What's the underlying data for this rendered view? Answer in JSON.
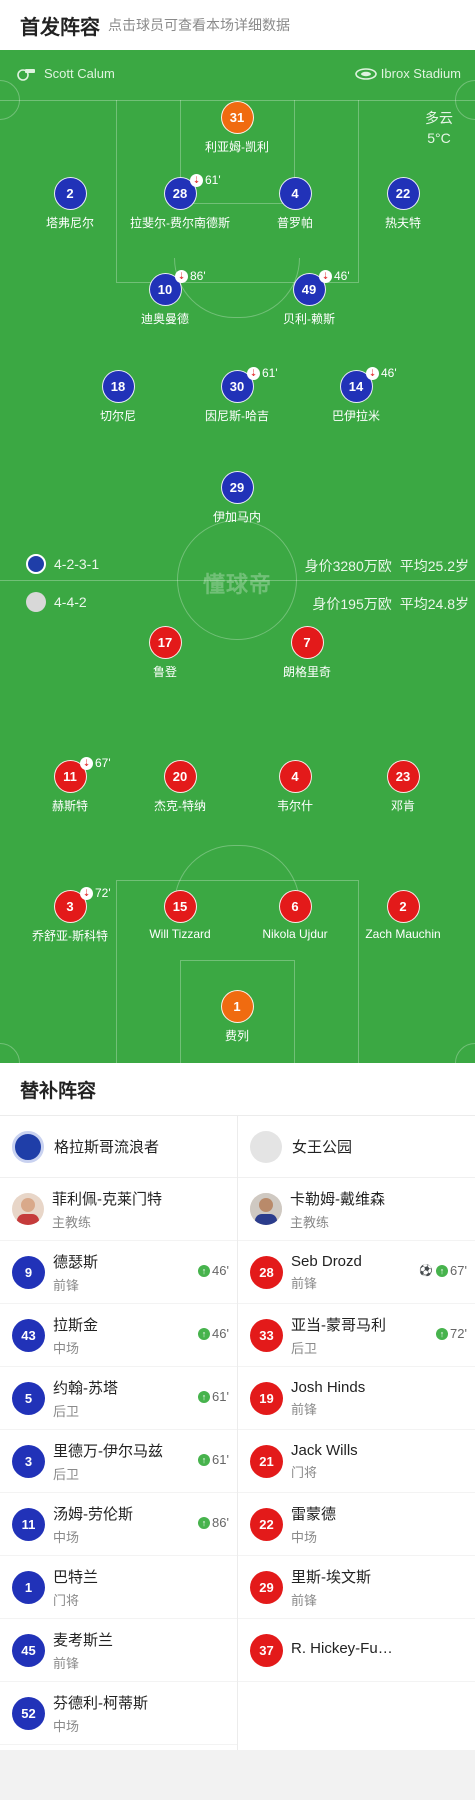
{
  "header": {
    "title": "首发阵容",
    "subtitle": "点击球员可查看本场详细数据"
  },
  "match": {
    "referee": "Scott Calum",
    "stadium": "Ibrox Stadium",
    "weather": "多云",
    "temperature": "5°C",
    "watermark": "懂球帝"
  },
  "home": {
    "formation": "4-2-3-1",
    "value": "身价3280万欧",
    "avg_age": "平均25.2岁"
  },
  "away": {
    "formation": "4-4-2",
    "value": "身价195万欧",
    "avg_age": "平均24.8岁"
  },
  "pitch_players": [
    {
      "num": "31",
      "name": "利亚姆-凯利",
      "color": "orange"
    },
    {
      "num": "2",
      "name": "塔弗尼尔",
      "color": "blue"
    },
    {
      "num": "28",
      "name": "拉斐尔-费尔南德斯",
      "color": "blue",
      "sub": "61'"
    },
    {
      "num": "4",
      "name": "普罗帕",
      "color": "blue"
    },
    {
      "num": "22",
      "name": "热夫特",
      "color": "blue"
    },
    {
      "num": "10",
      "name": "迪奥曼德",
      "color": "blue",
      "sub": "86'"
    },
    {
      "num": "49",
      "name": "贝利-赖斯",
      "color": "blue",
      "sub": "46'"
    },
    {
      "num": "18",
      "name": "切尔尼",
      "color": "blue"
    },
    {
      "num": "30",
      "name": "因尼斯-哈吉",
      "color": "blue",
      "sub": "61'"
    },
    {
      "num": "14",
      "name": "巴伊拉米",
      "color": "blue",
      "sub": "46'"
    },
    {
      "num": "29",
      "name": "伊加马内",
      "color": "blue"
    },
    {
      "num": "17",
      "name": "鲁登",
      "color": "red"
    },
    {
      "num": "7",
      "name": "朗格里奇",
      "color": "red"
    },
    {
      "num": "11",
      "name": "赫斯特",
      "color": "red",
      "sub": "67'"
    },
    {
      "num": "20",
      "name": "杰克-特纳",
      "color": "red"
    },
    {
      "num": "4",
      "name": "韦尔什",
      "color": "red"
    },
    {
      "num": "23",
      "name": "邓肯",
      "color": "red"
    },
    {
      "num": "3",
      "name": "乔舒亚-斯科特",
      "color": "red",
      "sub": "72'"
    },
    {
      "num": "15",
      "name": "Will Tizzard",
      "color": "red"
    },
    {
      "num": "6",
      "name": "Nikola Ujdur",
      "color": "red"
    },
    {
      "num": "2",
      "name": "Zach Mauchin",
      "color": "red"
    },
    {
      "num": "1",
      "name": "费列",
      "color": "orange"
    }
  ],
  "bench": {
    "title": "替补阵容",
    "home_team": "格拉斯哥流浪者",
    "away_team": "女王公园",
    "home_coach": {
      "name": "菲利佩-克莱门特",
      "role": "主教练"
    },
    "away_coach": {
      "name": "卡勒姆-戴维森",
      "role": "主教练"
    },
    "home": [
      {
        "num": "9",
        "name": "德瑟斯",
        "pos": "前锋",
        "sub": "46'"
      },
      {
        "num": "43",
        "name": "拉斯金",
        "pos": "中场",
        "sub": "46'"
      },
      {
        "num": "5",
        "name": "约翰-苏塔",
        "pos": "后卫",
        "sub": "61'"
      },
      {
        "num": "3",
        "name": "里德万-伊尔马兹",
        "pos": "后卫",
        "sub": "61'"
      },
      {
        "num": "11",
        "name": "汤姆-劳伦斯",
        "pos": "中场",
        "sub": "86'"
      },
      {
        "num": "1",
        "name": "巴特兰",
        "pos": "门将"
      },
      {
        "num": "45",
        "name": "麦考斯兰",
        "pos": "前锋"
      },
      {
        "num": "52",
        "name": "芬德利-柯蒂斯",
        "pos": "中场"
      }
    ],
    "away": [
      {
        "num": "28",
        "name": "Seb Drozd",
        "pos": "前锋",
        "sub": "67'",
        "goal": true
      },
      {
        "num": "33",
        "name": "亚当-蒙哥马利",
        "pos": "后卫",
        "sub": "72'"
      },
      {
        "num": "19",
        "name": "Josh Hinds",
        "pos": "前锋"
      },
      {
        "num": "21",
        "name": "Jack Wills",
        "pos": "门将"
      },
      {
        "num": "22",
        "name": "雷蒙德",
        "pos": "中场"
      },
      {
        "num": "29",
        "name": "里斯-埃文斯",
        "pos": "前锋"
      },
      {
        "num": "37",
        "name": "R. Hickey-Fugaccia",
        "pos": ""
      }
    ]
  },
  "colors": {
    "pitch": "#3ba843",
    "home": "#2132b8",
    "away": "#e31a1a",
    "keeper": "#f06b10",
    "sub_in": "#47b34d"
  }
}
